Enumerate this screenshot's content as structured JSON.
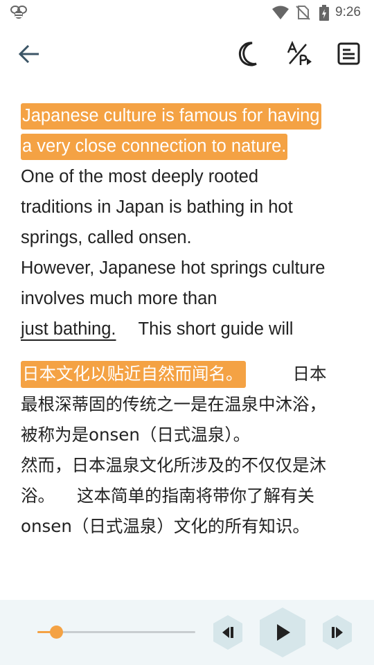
{
  "status_bar": {
    "time": "9:26",
    "icons": [
      "bee-icon",
      "wifi-icon",
      "no-sim-icon",
      "battery-icon"
    ]
  },
  "toolbar": {
    "icons": [
      "back-arrow-icon",
      "moon-icon",
      "translate-icon",
      "document-icon"
    ]
  },
  "reader": {
    "english": {
      "highlighted_sentence": "Japanese culture is famous for having a very close connection to nature.",
      "sentence_2": "One of the most deeply rooted traditions in Japan is bathing in hot springs, called onsen.",
      "sentence_3": "However, Japanese hot springs culture involves much more than",
      "sentence_3_underlined": "just bathing.",
      "sentence_4": "This short guide will"
    },
    "chinese": {
      "highlighted_sentence": "日本文化以贴近自然而闻名。",
      "sentence_2": "日本最根深蒂固的传统之一是在温泉中沐浴，被称为是onsen（日式温泉）。",
      "sentence_3": "然而，日本温泉文化所涉及的不仅仅是沐浴。",
      "sentence_4": "这本简单的指南将带你了解有关onsen（日式温泉）文化的所有知识。"
    }
  },
  "player": {
    "progress": 0.12,
    "accent_color": "#f4a244",
    "icons": [
      "previous-sentence-icon",
      "play-icon",
      "next-sentence-icon"
    ]
  }
}
